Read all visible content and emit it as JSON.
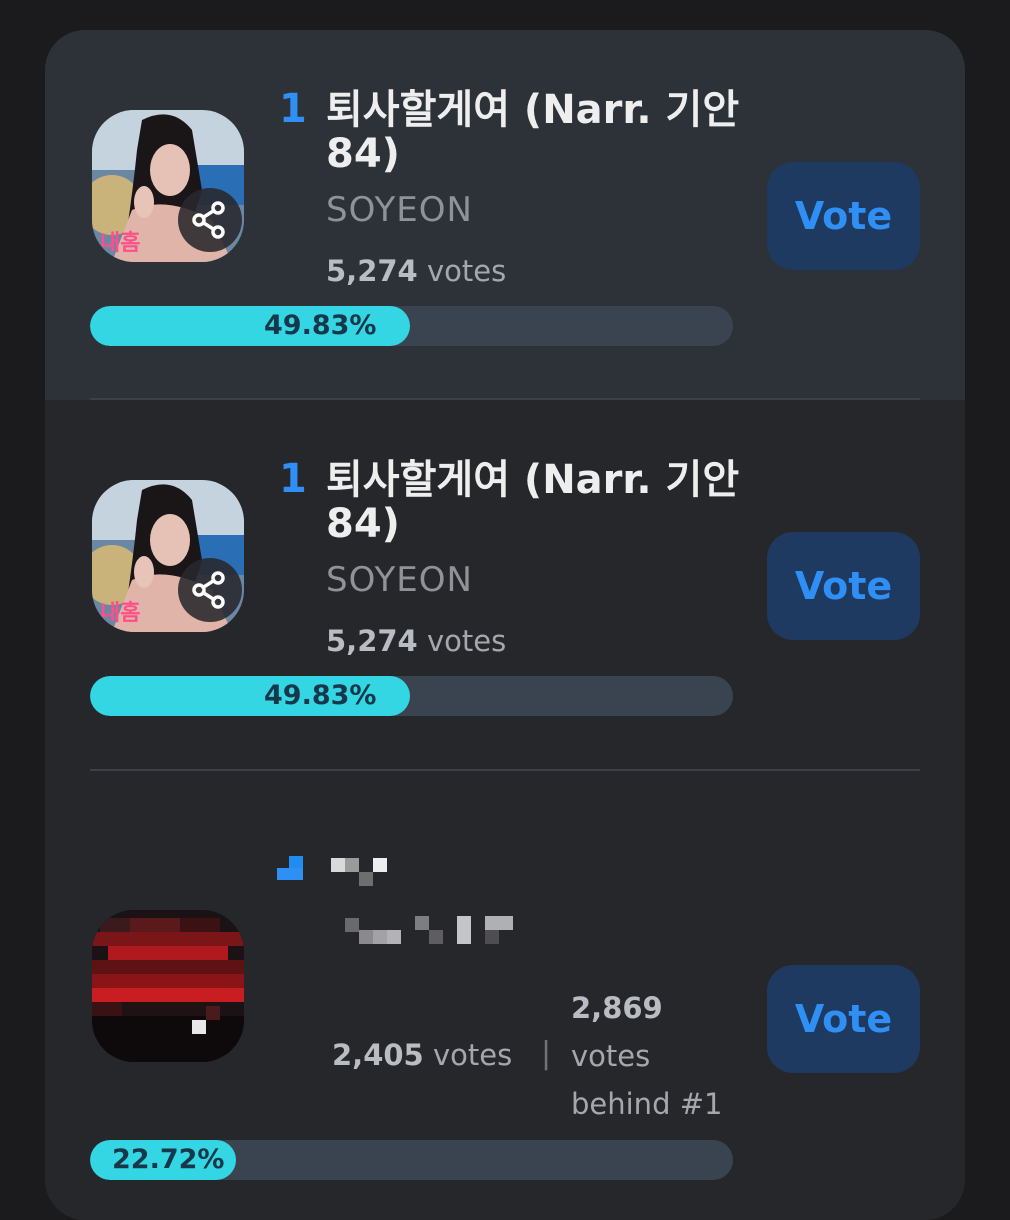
{
  "vote_label": "Vote",
  "entries": [
    {
      "rank": "1",
      "title": "퇴사할게여 (Narr. 기안84)",
      "artist": "SOYEON",
      "votes_number": "5,274",
      "votes_suffix": "votes",
      "percent": "49.83%",
      "percent_value": 49.83,
      "highlighted": true
    },
    {
      "rank": "1",
      "title": "퇴사할게여 (Narr. 기안84)",
      "artist": "SOYEON",
      "votes_number": "5,274",
      "votes_suffix": "votes",
      "percent": "49.83%",
      "percent_value": 49.83,
      "highlighted": false
    },
    {
      "votes_number": "2,405",
      "votes_suffix": "votes",
      "separator": "|",
      "behind_number": "2,869",
      "behind_text_1": "votes",
      "behind_text_2": "behind #1",
      "percent": "22.72%",
      "percent_value": 22.72
    }
  ],
  "colors": {
    "accent": "#2f8ff5",
    "bar_fill": "#35d6e4",
    "bar_track": "#3a4350",
    "vote_button_bg": "#1f3a60"
  },
  "icons": {
    "share": "share-icon"
  }
}
